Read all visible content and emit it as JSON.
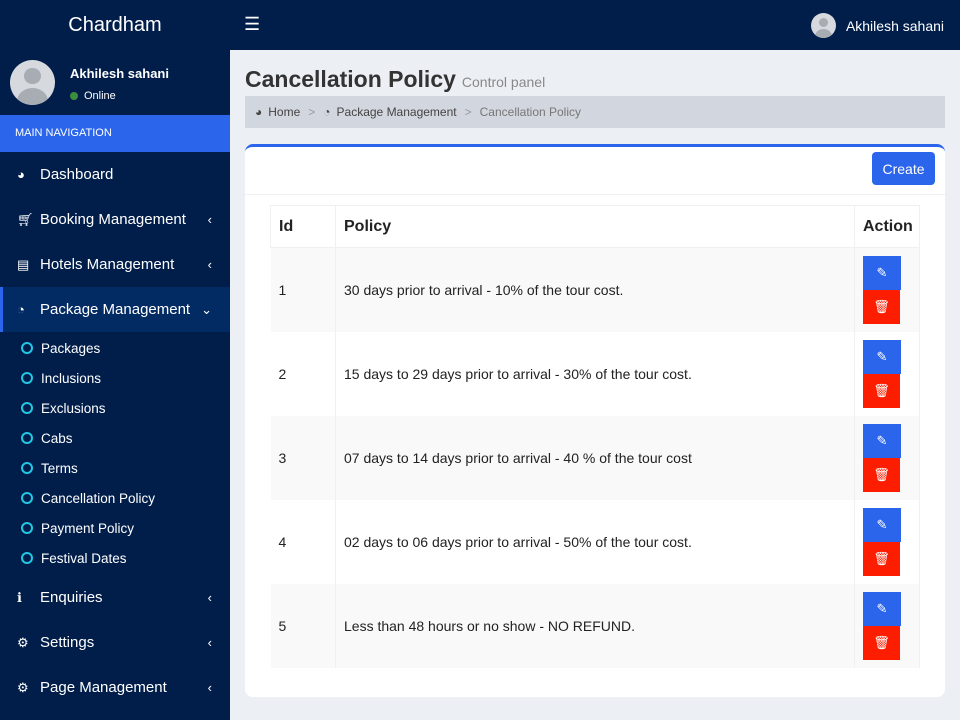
{
  "app": {
    "brand": "Chardham",
    "user": "Akhilesh sahani",
    "status": "Online"
  },
  "sidebar": {
    "header": "MAIN NAVIGATION",
    "items": [
      {
        "label": "Dashboard",
        "icon": "dashboard-icon"
      },
      {
        "label": "Booking Management",
        "icon": "cart-icon"
      },
      {
        "label": "Hotels Management",
        "icon": "bed-icon"
      },
      {
        "label": "Package Management",
        "icon": "pie-chart-icon"
      }
    ],
    "subitems": [
      "Packages",
      "Inclusions",
      "Exclusions",
      "Cabs",
      "Terms",
      "Cancellation Policy",
      "Payment Policy",
      "Festival Dates"
    ],
    "items2": [
      {
        "label": "Enquiries"
      },
      {
        "label": "Settings"
      },
      {
        "label": "Page Management"
      }
    ]
  },
  "page": {
    "title": "Cancellation Policy",
    "subtitle": "Control panel",
    "breadcrumb": [
      "Home",
      "Package Management",
      "Cancellation Policy"
    ],
    "create": "Create",
    "columns": [
      "Id",
      "Policy",
      "Action"
    ],
    "rows": [
      {
        "id": "1",
        "policy": "30 days prior to arrival - 10% of the tour cost."
      },
      {
        "id": "2",
        "policy": "15 days to 29 days prior to arrival - 30% of the tour cost."
      },
      {
        "id": "3",
        "policy": "07 days to 14 days prior to arrival - 40 % of the tour cost"
      },
      {
        "id": "4",
        "policy": "02 days to 06 days prior to arrival - 50% of the tour cost."
      },
      {
        "id": "5",
        "policy": "Less than 48 hours or no show - NO REFUND."
      }
    ]
  }
}
